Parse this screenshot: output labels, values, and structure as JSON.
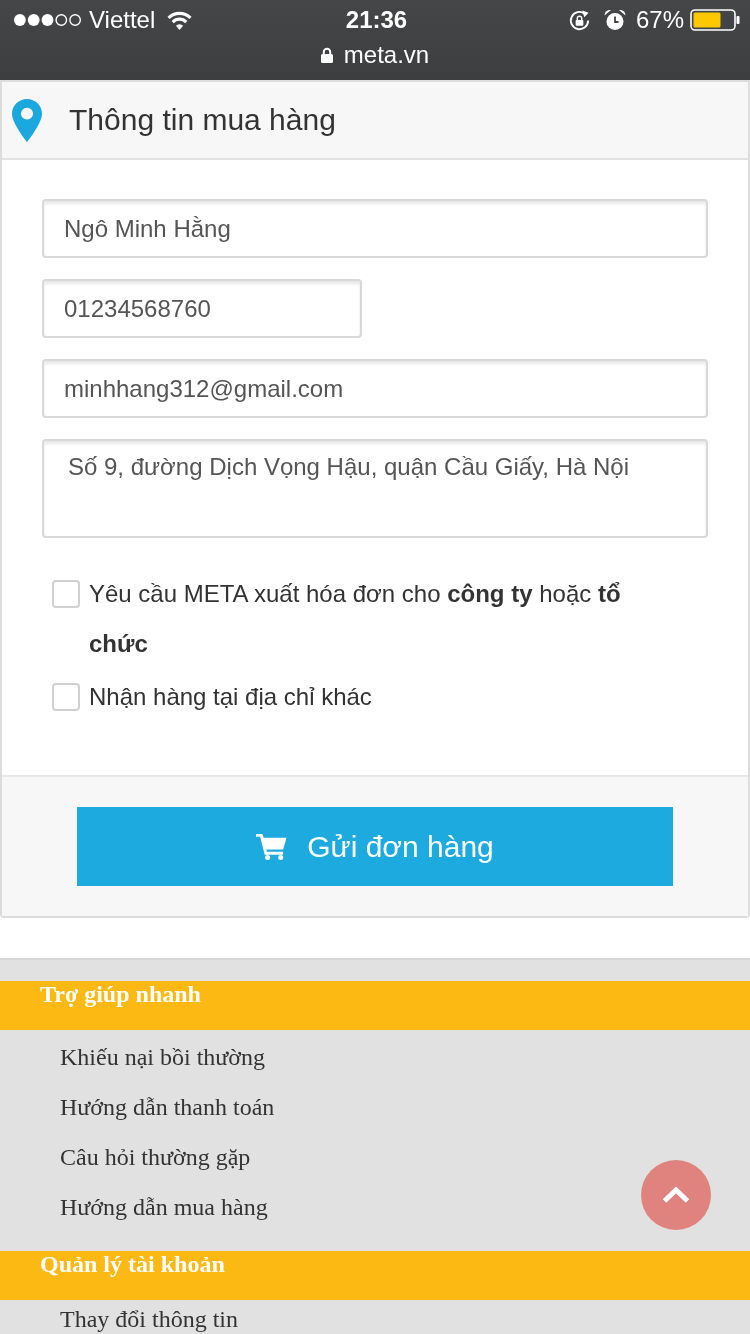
{
  "status_bar": {
    "carrier": "Viettel",
    "time": "21:36",
    "battery": "67%",
    "url": "meta.vn"
  },
  "panel": {
    "title": "Thông tin mua hàng",
    "fields": [
      {
        "kind": "name",
        "value": "Ngô Minh Hằng"
      },
      {
        "kind": "phone",
        "value": "01234568760"
      },
      {
        "kind": "email",
        "value": "minhhang312@gmail.com"
      },
      {
        "kind": "address",
        "value": "Số 9, đường Dịch Vọng Hậu, quận Cầu Giấy, Hà Nội"
      }
    ],
    "options": [
      {
        "label": "Yêu cầu META xuất hóa đơn cho **công ty** hoặc **tổ chức**",
        "checked": false
      },
      {
        "label": "Nhận hàng tại địa chỉ khác",
        "checked": false
      }
    ],
    "submit_button": "Gửi đơn hàng"
  },
  "footer": {
    "sections": [
      {
        "title": "Trợ giúp nhanh",
        "links": [
          "Khiếu nại bồi thường",
          "Hướng dẫn thanh toán",
          "Câu hỏi thường gặp",
          "Hướng dẫn mua hàng"
        ]
      },
      {
        "title": "Quản lý tài khoản",
        "links": [
          "Thay đổi thông tin"
        ]
      }
    ]
  }
}
